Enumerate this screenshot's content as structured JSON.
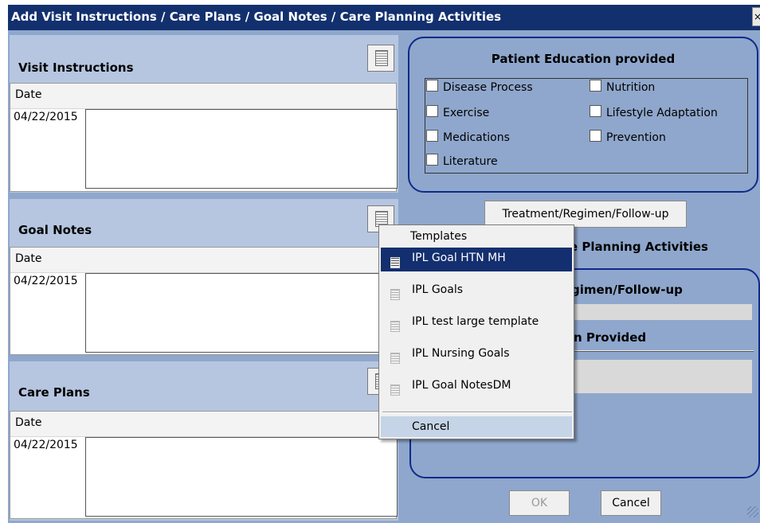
{
  "window": {
    "title": "Add Visit Instructions / Care Plans / Goal Notes / Care Planning Activities",
    "close_glyph": "×"
  },
  "visit_instructions": {
    "label": "Visit Instructions",
    "column_header": "Date",
    "date": "04/22/2015"
  },
  "goal_notes": {
    "label": "Goal Notes",
    "column_header": "Date",
    "date": "04/22/2015"
  },
  "care_plans": {
    "label": "Care Plans",
    "column_header": "Date",
    "date": "04/22/2015"
  },
  "patient_education": {
    "title": "Patient Education provided",
    "items": [
      {
        "label": "Disease Process",
        "checked": false
      },
      {
        "label": "Nutrition",
        "checked": false
      },
      {
        "label": "Exercise",
        "checked": false
      },
      {
        "label": "Lifestyle Adaptation",
        "checked": false
      },
      {
        "label": "Medications",
        "checked": false
      },
      {
        "label": "Prevention",
        "checked": false
      },
      {
        "label": "Literature",
        "checked": false
      }
    ]
  },
  "treatment_button": {
    "label": "Treatment/Regimen/Follow-up"
  },
  "care_planning": {
    "heading_visible": "e Planning Activities",
    "sub1_visible": "gimen/Follow-up",
    "sub2_visible": "n Provided"
  },
  "templates_menu": {
    "header": "Templates",
    "items": [
      {
        "label": "IPL Goal HTN MH",
        "selected": true
      },
      {
        "label": "IPL Goals",
        "selected": false
      },
      {
        "label": "IPL test large template",
        "selected": false
      },
      {
        "label": "IPL Nursing Goals",
        "selected": false
      },
      {
        "label": "IPL Goal NotesDM",
        "selected": false
      }
    ],
    "cancel": "Cancel"
  },
  "footer": {
    "ok": "OK",
    "cancel": "Cancel"
  },
  "colors": {
    "title_bar": "#13306e",
    "dialog_background": "#8fa7cc",
    "section_background": "#b6c6e0",
    "group_border": "#0e2a8a",
    "menu_highlight": "#132f6f"
  }
}
